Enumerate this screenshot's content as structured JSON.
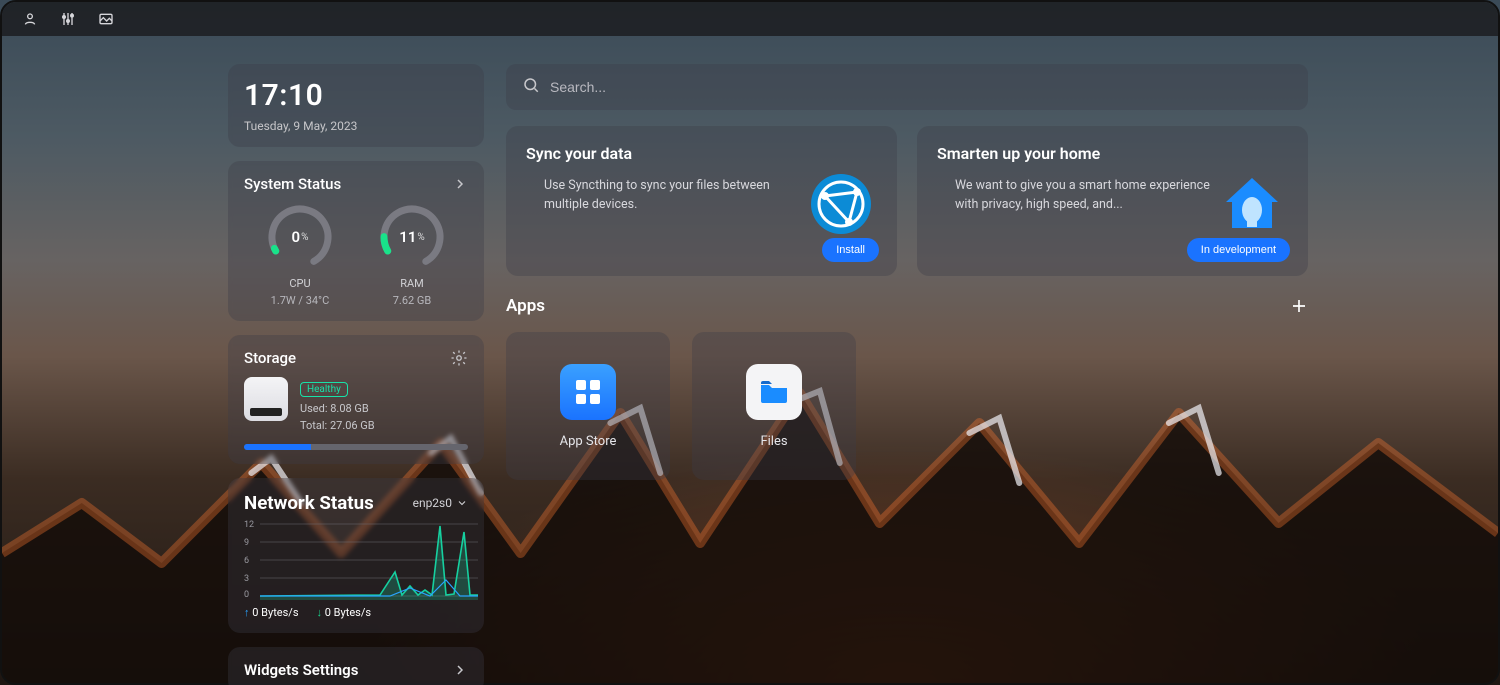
{
  "clock": {
    "time": "17:10",
    "date": "Tuesday, 9 May, 2023"
  },
  "system_status": {
    "title": "System Status",
    "cpu": {
      "value": "0",
      "unit": "%",
      "label": "CPU",
      "sub": "1.7W / 34°C",
      "fraction": 0.02
    },
    "ram": {
      "value": "11",
      "unit": "%",
      "label": "RAM",
      "sub": "7.62 GB",
      "fraction": 0.11
    }
  },
  "storage": {
    "title": "Storage",
    "health": "Healthy",
    "used_label": "Used: 8.08 GB",
    "total_label": "Total: 27.06 GB",
    "used_fraction": 0.3
  },
  "network": {
    "title": "Network Status",
    "iface": "enp2s0",
    "y_ticks": [
      "12",
      "9",
      "6",
      "3",
      "0"
    ],
    "up": "0 Bytes/s",
    "down": "0 Bytes/s"
  },
  "widgets_settings": {
    "title": "Widgets Settings"
  },
  "search": {
    "placeholder": "Search..."
  },
  "promos": [
    {
      "title": "Sync your data",
      "body": "Use Syncthing to sync your files between multiple devices.",
      "button": "Install",
      "icon": "syncthing"
    },
    {
      "title": "Smarten up your home",
      "body": "We want to give you a smart home experience with privacy, high speed, and...",
      "button": "In development",
      "icon": "home-assistant"
    }
  ],
  "apps": {
    "title": "Apps",
    "items": [
      {
        "label": "App Store",
        "icon": "grid"
      },
      {
        "label": "Files",
        "icon": "folder"
      }
    ]
  }
}
